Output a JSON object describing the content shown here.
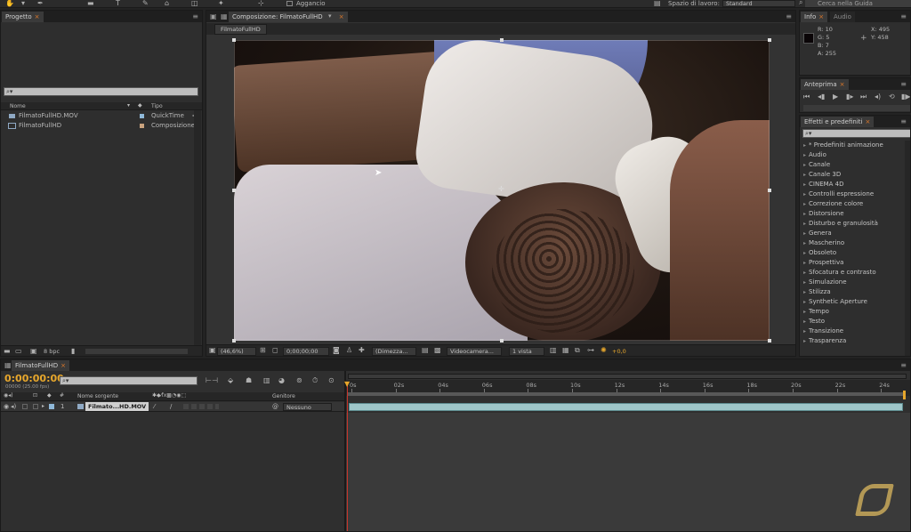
{
  "topbar": {
    "aggancio": "Aggancio",
    "workspace_label": "Spazio di lavoro:",
    "workspace_value": "Standard",
    "search_placeholder": "Cerca nella Guida"
  },
  "project": {
    "tab": "Progetto",
    "search_placeholder": "",
    "col_name": "Nome",
    "col_type": "Tipo",
    "items": [
      {
        "name": "FilmatoFullHD.MOV",
        "type": "QuickTime",
        "color": "#8fb8d8"
      },
      {
        "name": "FilmatoFullHD",
        "type": "Composizione",
        "color": "#c9a27e"
      }
    ],
    "bpc": "8 bpc"
  },
  "composition": {
    "tab": "Composizione: FilmatoFullHD",
    "subtab": "FilmatoFullHD",
    "zoom": "(46,6%)",
    "timecode": "0;00;00;00",
    "resolution": "(Dimezza...",
    "camera": "Videocamera...",
    "views": "1 vista",
    "exposure": "+0,0"
  },
  "info": {
    "tab": "Info",
    "tab2": "Audio",
    "r": "R: 10",
    "g": "G: 5",
    "b": "B: 7",
    "a": "A: 255",
    "x": "X: 495",
    "y": "Y: 458",
    "swatch": "#0a0507"
  },
  "preview": {
    "tab": "Anteprima"
  },
  "effects": {
    "tab": "Effetti e predefiniti",
    "items": [
      "* Predefiniti animazione",
      "Audio",
      "Canale",
      "Canale 3D",
      "CINEMA 4D",
      "Controlli espressione",
      "Correzione colore",
      "Distorsione",
      "Disturbo e granulosità",
      "Genera",
      "Mascherino",
      "Obsoleto",
      "Prospettiva",
      "Sfocatura e contrasto",
      "Simulazione",
      "Stilizza",
      "Synthetic Aperture",
      "Tempo",
      "Testo",
      "Transizione",
      "Trasparenza"
    ]
  },
  "timeline": {
    "tab": "FilmatoFullHD",
    "timecode": "0:00:00:00",
    "fps": "00000 (25.00 fps)",
    "col_name": "Nome sorgente",
    "col_parent": "Genitore",
    "layer_num": "1",
    "layer_name": "Filmato...HD.MOV",
    "parent_value": "Nessuno",
    "ticks": [
      "0s",
      "02s",
      "04s",
      "06s",
      "08s",
      "10s",
      "12s",
      "14s",
      "16s",
      "18s",
      "20s",
      "22s",
      "24s"
    ]
  },
  "colors": {
    "accent": "#e7a72c",
    "layer_bar": "#9ec6c9",
    "playhead": "#c8342a"
  }
}
